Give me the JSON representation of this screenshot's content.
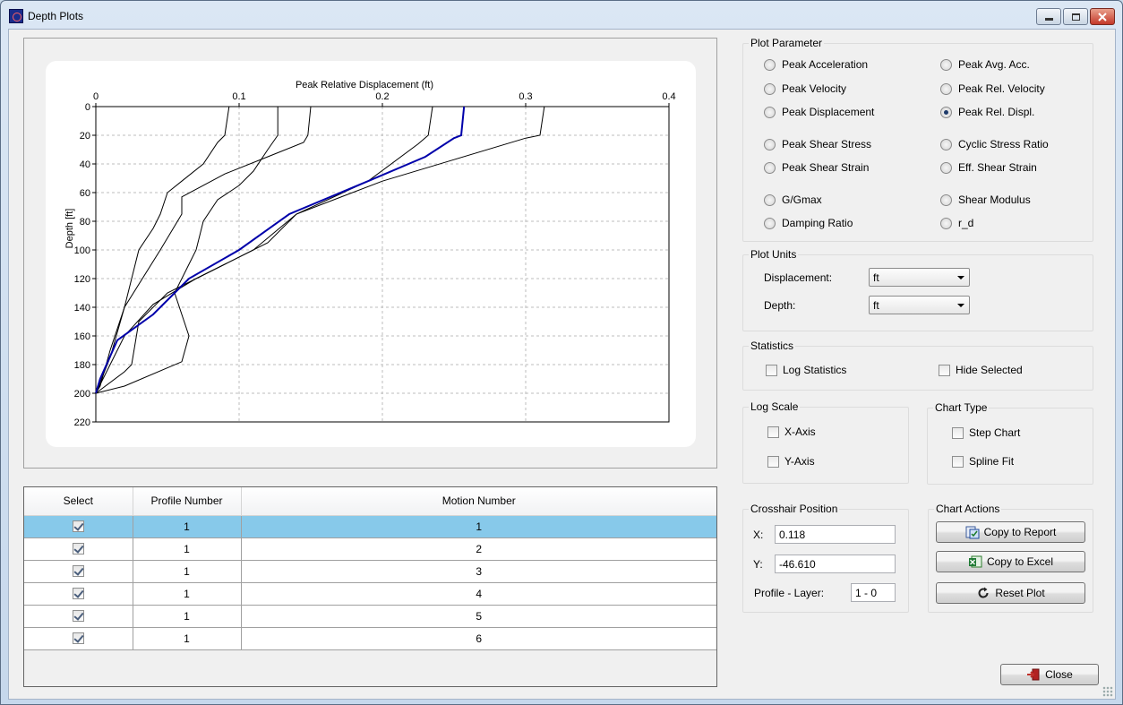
{
  "window": {
    "title": "Depth Plots"
  },
  "chart_data": {
    "type": "line",
    "title": "Peak Relative Displacement (ft)",
    "ylabel": "Depth [ft]",
    "xlim": [
      0,
      0.4
    ],
    "ylim": [
      0,
      220
    ],
    "y_inverted": true,
    "x_axis_position": "top",
    "x_ticks": [
      "0",
      "0.1",
      "0.2",
      "0.3",
      "0.4"
    ],
    "y_ticks": [
      "0",
      "20",
      "40",
      "60",
      "80",
      "100",
      "120",
      "140",
      "160",
      "180",
      "200",
      "220"
    ],
    "grid": true,
    "highlight_color": "#0000aa",
    "line_color": "#000000",
    "series": [
      {
        "selected": true,
        "points": [
          [
            0.257,
            0
          ],
          [
            0.255,
            20
          ],
          [
            0.25,
            22
          ],
          [
            0.23,
            35
          ],
          [
            0.19,
            52
          ],
          [
            0.135,
            75
          ],
          [
            0.1,
            100
          ],
          [
            0.065,
            120
          ],
          [
            0.05,
            135
          ],
          [
            0.04,
            145
          ],
          [
            0.015,
            163
          ],
          [
            0.003,
            190
          ],
          [
            0,
            200
          ]
        ]
      },
      {
        "selected": false,
        "points": [
          [
            0.093,
            0
          ],
          [
            0.09,
            20
          ],
          [
            0.085,
            25
          ],
          [
            0.075,
            40
          ],
          [
            0.06,
            52
          ],
          [
            0.05,
            60
          ],
          [
            0.045,
            75
          ],
          [
            0.04,
            85
          ],
          [
            0.03,
            100
          ],
          [
            0.02,
            140
          ],
          [
            0.01,
            170
          ],
          [
            0.003,
            195
          ],
          [
            0,
            200
          ]
        ]
      },
      {
        "selected": false,
        "points": [
          [
            0.127,
            0
          ],
          [
            0.127,
            20
          ],
          [
            0.12,
            30
          ],
          [
            0.11,
            45
          ],
          [
            0.1,
            55
          ],
          [
            0.085,
            65
          ],
          [
            0.075,
            80
          ],
          [
            0.07,
            100
          ],
          [
            0.065,
            110
          ],
          [
            0.055,
            130
          ],
          [
            0.065,
            160
          ],
          [
            0.06,
            178
          ],
          [
            0.02,
            195
          ],
          [
            0,
            200
          ]
        ]
      },
      {
        "selected": false,
        "points": [
          [
            0.15,
            0
          ],
          [
            0.148,
            20
          ],
          [
            0.145,
            25
          ],
          [
            0.12,
            35
          ],
          [
            0.09,
            47
          ],
          [
            0.06,
            63
          ],
          [
            0.06,
            75
          ],
          [
            0.045,
            100
          ],
          [
            0.02,
            140
          ],
          [
            0.01,
            175
          ],
          [
            0.002,
            195
          ],
          [
            0,
            200
          ]
        ]
      },
      {
        "selected": false,
        "points": [
          [
            0.235,
            0
          ],
          [
            0.232,
            20
          ],
          [
            0.225,
            26
          ],
          [
            0.19,
            52
          ],
          [
            0.14,
            75
          ],
          [
            0.12,
            95
          ],
          [
            0.09,
            110
          ],
          [
            0.05,
            130
          ],
          [
            0.03,
            150
          ],
          [
            0.025,
            180
          ],
          [
            0.02,
            185
          ],
          [
            0,
            200
          ]
        ]
      },
      {
        "selected": false,
        "points": [
          [
            0.313,
            0
          ],
          [
            0.31,
            20
          ],
          [
            0.3,
            22
          ],
          [
            0.25,
            37
          ],
          [
            0.2,
            52
          ],
          [
            0.14,
            75
          ],
          [
            0.11,
            100
          ],
          [
            0.07,
            120
          ],
          [
            0.04,
            138
          ],
          [
            0.02,
            160
          ],
          [
            0.01,
            180
          ],
          [
            0,
            200
          ]
        ]
      }
    ]
  },
  "grid_table": {
    "headers": {
      "select": "Select",
      "profile": "Profile Number",
      "motion": "Motion Number"
    },
    "rows": [
      {
        "profile": "1",
        "motion": "1",
        "selected": true
      },
      {
        "profile": "1",
        "motion": "2",
        "selected": false
      },
      {
        "profile": "1",
        "motion": "3",
        "selected": false
      },
      {
        "profile": "1",
        "motion": "4",
        "selected": false
      },
      {
        "profile": "1",
        "motion": "5",
        "selected": false
      },
      {
        "profile": "1",
        "motion": "6",
        "selected": false
      }
    ]
  },
  "plot_parameter": {
    "title": "Plot Parameter",
    "options": [
      "Peak Acceleration",
      "Peak Avg. Acc.",
      "Peak Velocity",
      "Peak Rel. Velocity",
      "Peak Displacement",
      "Peak Rel. Displ.",
      "Peak Shear Stress",
      "Cyclic Stress Ratio",
      "Peak Shear Strain",
      "Eff. Shear Strain",
      "G/Gmax",
      "Shear Modulus",
      "Damping Ratio",
      "r_d"
    ],
    "selected": "Peak Rel. Displ."
  },
  "plot_units": {
    "title": "Plot Units",
    "displacement_label": "Displacement:",
    "displacement_value": "ft",
    "depth_label": "Depth:",
    "depth_value": "ft"
  },
  "statistics": {
    "title": "Statistics",
    "log_statistics": "Log Statistics",
    "hide_selected": "Hide Selected"
  },
  "log_scale": {
    "title": "Log Scale",
    "x_axis": "X-Axis",
    "y_axis": "Y-Axis"
  },
  "chart_type": {
    "title": "Chart Type",
    "step_chart": "Step Chart",
    "spline_fit": "Spline Fit"
  },
  "crosshair": {
    "title": "Crosshair Position",
    "x_label": "X:",
    "x_value": "0.118",
    "y_label": "Y:",
    "y_value": "-46.610",
    "profile_layer_label": "Profile - Layer:",
    "profile_layer_value": "1 - 0"
  },
  "chart_actions": {
    "title": "Chart Actions",
    "copy_to_report": "Copy to Report",
    "copy_to_excel": "Copy to Excel",
    "reset_plot": "Reset Plot"
  },
  "footer": {
    "close": "Close"
  }
}
